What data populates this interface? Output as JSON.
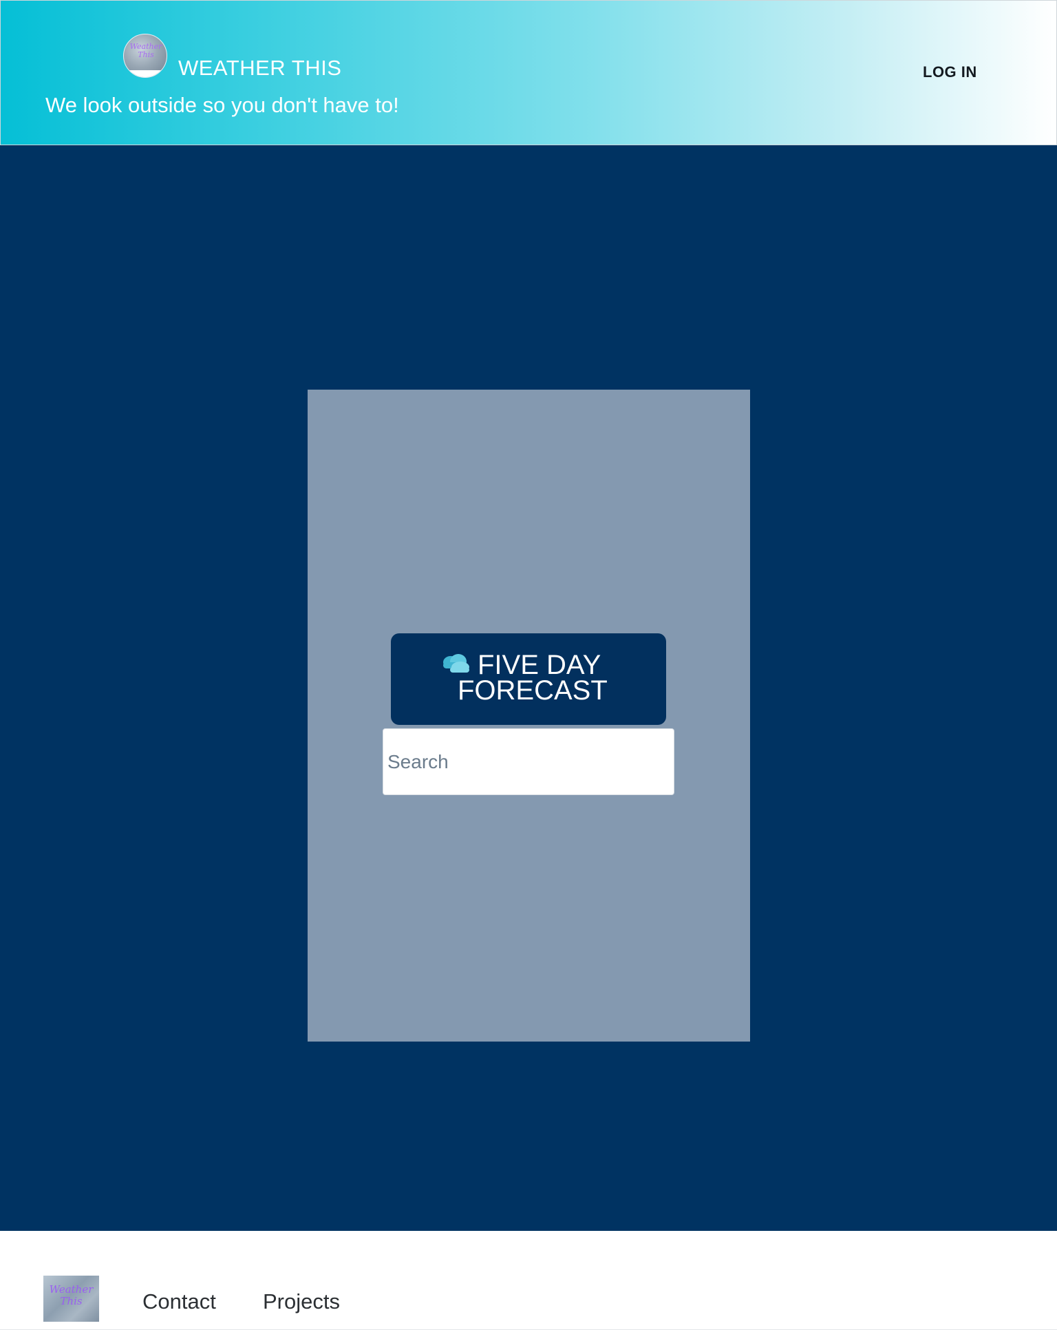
{
  "header": {
    "logo_text": "Weather This",
    "brand_title": "WEATHER THIS",
    "tagline": "We look outside so you don't have to!",
    "login_label": "LOG IN",
    "gradient_start": "#05bfd6",
    "gradient_end": "#ffffff"
  },
  "main": {
    "background": "#003362",
    "panel_color": "#8499b0",
    "forecast": {
      "line1": "FIVE DAY",
      "line2": "FORECAST",
      "icon": "cloud-icon"
    },
    "search": {
      "placeholder": "Search",
      "value": ""
    }
  },
  "footer": {
    "logo_text": "Weather This",
    "links": [
      {
        "label": "Contact"
      },
      {
        "label": "Projects"
      }
    ]
  }
}
